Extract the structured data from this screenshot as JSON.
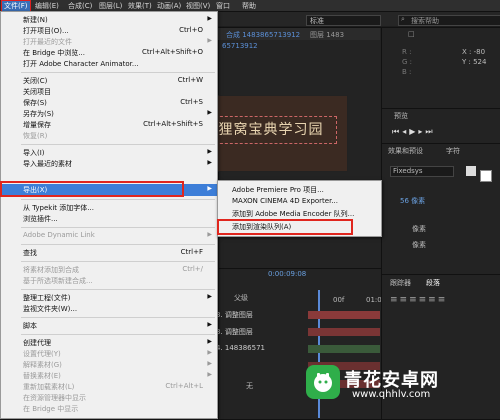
{
  "menubar": {
    "items": [
      "文件(F)",
      "编辑(E)",
      "合成(C)",
      "图层(L)",
      "效果(T)",
      "动画(A)",
      "视图(V)",
      "窗口",
      "帮助"
    ]
  },
  "background": {
    "tab_composition": "合成 1483865713912",
    "tab_layer": "图层 1483",
    "comp_sub": "65713912",
    "preset_label": "标准",
    "search_placeholder": "搜索帮助",
    "info": {
      "x": "X : -80",
      "y": "Y : 524"
    },
    "preview_tab": "预览",
    "effects_tab": "效果和预设",
    "character_tab": "字符",
    "font_name": "Fixedsys",
    "font_size": "56 像素",
    "size_unit": "像素",
    "timecode": "0:00:09:08",
    "timeline_tab1": "跟踪器",
    "timeline_tab2": "段落",
    "parent_label": "父级",
    "timeline_layers": [
      "3. 调整图层",
      "3. 调整图层",
      "4. 148386571"
    ],
    "none_label": "无",
    "ruler": [
      "00f",
      "01:00f"
    ],
    "title_text": "狸窝宝典学习园"
  },
  "file_menu": {
    "items": [
      {
        "label": "新建(N)",
        "shortcut": "",
        "submenu": true,
        "disabled": false
      },
      {
        "label": "打开项目(O)...",
        "shortcut": "Ctrl+O",
        "submenu": false,
        "disabled": false
      },
      {
        "label": "打开最近的文件",
        "shortcut": "",
        "submenu": true,
        "disabled": true
      },
      {
        "label": "在 Bridge 中浏览...",
        "shortcut": "Ctrl+Alt+Shift+O",
        "submenu": false,
        "disabled": false
      },
      {
        "label": "打开 Adobe Character Animator...",
        "shortcut": "",
        "submenu": false,
        "disabled": false
      },
      {
        "label": "关闭(C)",
        "shortcut": "Ctrl+W",
        "submenu": false,
        "disabled": false
      },
      {
        "label": "关闭项目",
        "shortcut": "",
        "submenu": false,
        "disabled": false
      },
      {
        "label": "保存(S)",
        "shortcut": "Ctrl+S",
        "submenu": false,
        "disabled": false
      },
      {
        "label": "另存为(S)",
        "shortcut": "",
        "submenu": true,
        "disabled": false
      },
      {
        "label": "增量保存",
        "shortcut": "Ctrl+Alt+Shift+S",
        "submenu": false,
        "disabled": false
      },
      {
        "label": "恢复(R)",
        "shortcut": "",
        "submenu": false,
        "disabled": true
      },
      {
        "label": "导入(I)",
        "shortcut": "",
        "submenu": true,
        "disabled": false
      },
      {
        "label": "导入最近的素材",
        "shortcut": "",
        "submenu": true,
        "disabled": false
      },
      {
        "label": "导出(X)",
        "shortcut": "",
        "submenu": true,
        "disabled": false
      },
      {
        "label": "从 Typekit 添加字体...",
        "shortcut": "",
        "submenu": false,
        "disabled": false
      },
      {
        "label": "浏览插件...",
        "shortcut": "",
        "submenu": false,
        "disabled": false
      },
      {
        "label": "Adobe Dynamic Link",
        "shortcut": "",
        "submenu": true,
        "disabled": true
      },
      {
        "label": "查找",
        "shortcut": "Ctrl+F",
        "submenu": false,
        "disabled": false
      },
      {
        "label": "将素材添加到合成",
        "shortcut": "Ctrl+/",
        "submenu": false,
        "disabled": true
      },
      {
        "label": "基于所选项新建合成...",
        "shortcut": "",
        "submenu": false,
        "disabled": true
      },
      {
        "label": "整理工程(文件)",
        "shortcut": "",
        "submenu": true,
        "disabled": false
      },
      {
        "label": "监视文件夹(W)...",
        "shortcut": "",
        "submenu": false,
        "disabled": false
      },
      {
        "label": "脚本",
        "shortcut": "",
        "submenu": true,
        "disabled": false
      },
      {
        "label": "创建代理",
        "shortcut": "",
        "submenu": true,
        "disabled": false
      },
      {
        "label": "设置代理(Y)",
        "shortcut": "",
        "submenu": true,
        "disabled": true
      },
      {
        "label": "解释素材(G)",
        "shortcut": "",
        "submenu": true,
        "disabled": true
      },
      {
        "label": "替换素材(E)",
        "shortcut": "",
        "submenu": true,
        "disabled": true
      },
      {
        "label": "重新加载素材(L)",
        "shortcut": "Ctrl+Alt+L",
        "submenu": false,
        "disabled": true
      },
      {
        "label": "在资源管理器中显示",
        "shortcut": "",
        "submenu": false,
        "disabled": true
      },
      {
        "label": "在 Bridge 中显示",
        "shortcut": "",
        "submenu": false,
        "disabled": true
      }
    ]
  },
  "export_menu": {
    "items": [
      "Adobe Premiere Pro 项目...",
      "MAXON CINEMA 4D Exporter...",
      "添加到 Adobe Media Encoder 队列...",
      "添加到渲染队列(A)"
    ]
  },
  "watermark": {
    "brand": "青花安卓网",
    "url": "www.qhhlv.com"
  },
  "colors": {
    "menu_bg": "#f0f0f0",
    "highlight": "#3d7ed8",
    "annotation_red": "#e0261e",
    "app_bg": "#1d1d1d"
  }
}
